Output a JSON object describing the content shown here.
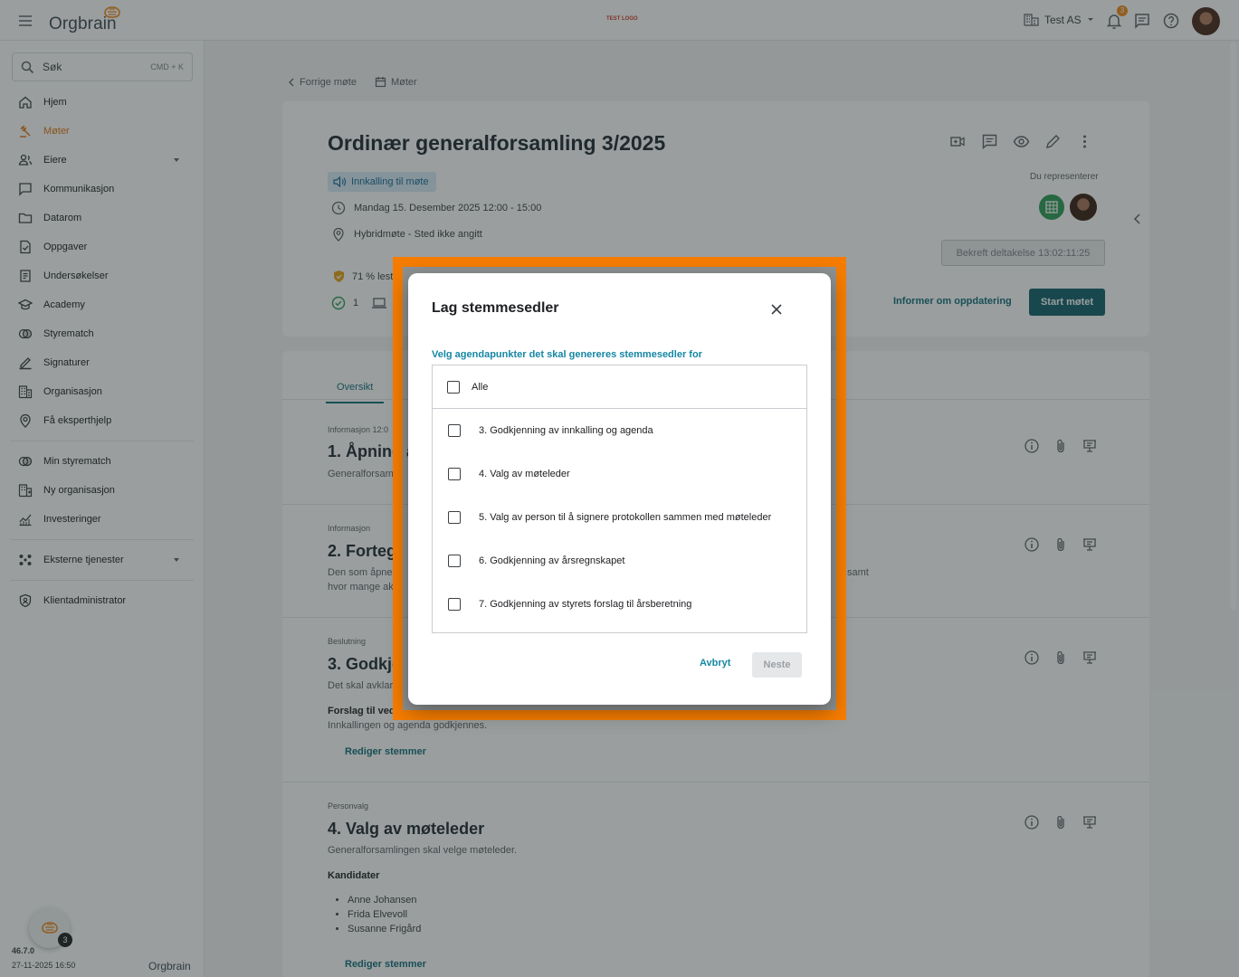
{
  "app": {
    "logo_text": "Orgbrain",
    "env_badge": "TEST LOGO",
    "org_name": "Test AS",
    "notification_count": "3"
  },
  "sidebar": {
    "search_label": "Søk",
    "search_shortcut": "CMD + K",
    "items": [
      {
        "label": "Hjem",
        "icon": "home-icon"
      },
      {
        "label": "Møter",
        "icon": "gavel-icon"
      },
      {
        "label": "Eiere",
        "icon": "owners-icon"
      },
      {
        "label": "Kommunikasjon",
        "icon": "chat-icon"
      },
      {
        "label": "Datarom",
        "icon": "folder-icon"
      },
      {
        "label": "Oppgaver",
        "icon": "task-icon"
      },
      {
        "label": "Undersøkelser",
        "icon": "survey-icon"
      },
      {
        "label": "Academy",
        "icon": "academy-icon"
      },
      {
        "label": "Styrematch",
        "icon": "match-icon"
      },
      {
        "label": "Signaturer",
        "icon": "signature-icon"
      },
      {
        "label": "Organisasjon",
        "icon": "organization-icon"
      },
      {
        "label": "Få eksperthjelp",
        "icon": "expert-icon"
      }
    ],
    "secondary_items": [
      {
        "label": "Min styrematch",
        "icon": "match-icon"
      },
      {
        "label": "Ny organisasjon",
        "icon": "new-organization-icon"
      },
      {
        "label": "Investeringer",
        "icon": "investments-icon"
      }
    ],
    "external_services": "Eksterne tjenester",
    "client_admin": "Klientadministrator",
    "version": "46.7.0",
    "build_date": "27-11-2025 16:50",
    "footer_logo": "Orgbrain",
    "fab_badge": "3"
  },
  "breadcrumb": {
    "previous": "Forrige møte",
    "meetings": "Møter"
  },
  "meeting": {
    "title": "Ordinær generalforsamling 3/2025",
    "status": "Innkalling til møte",
    "datetime": "Mandag 15. Desember 2025 12:00 - 15:00",
    "location": "Hybridmøte - Sted ikke angitt",
    "read_pct": "71 % lest",
    "check_count": "1",
    "represent_label": "Du representerer",
    "confirm_button": "Bekreft deltakelse 13:02:11:25",
    "inform_link": "Informer om oppdatering",
    "start_button": "Start møtet"
  },
  "tabs": {
    "overview": "Oversikt"
  },
  "agenda": [
    {
      "type": "Informasjon 12:0",
      "title": "1. Åpning a",
      "desc": "Generalforsam"
    },
    {
      "type": "Informasjon",
      "title": "2. Forteg",
      "desc1": "Den som åpne",
      "desc2": "hvor mange ak",
      "desc_tail": "samt"
    },
    {
      "type": "Beslutning",
      "title": "3. Godkje",
      "desc": "Det skal avklar",
      "sub": "Forslag til ved",
      "proposal": "Innkallingen og agenda godkjennes.",
      "link": "Rediger stemmer"
    },
    {
      "type": "Personvalg",
      "title": "4. Valg av møteleder",
      "desc": "Generalforsamlingen skal velge møteleder.",
      "sub": "Kandidater",
      "candidates": [
        "Anne Johansen",
        "Frida Elvevoll",
        "Susanne Frigård"
      ],
      "link": "Rediger stemmer"
    }
  ],
  "dialog": {
    "title": "Lag stemmesedler",
    "prompt": "Velg agendapunkter det skal genereres stemmesedler for",
    "all_label": "Alle",
    "options": [
      "3. Godkjenning av innkalling og agenda",
      "4. Valg av møteleder",
      "5. Valg av person til å signere protokollen sammen med møteleder",
      "6. Godkjenning av årsregnskapet",
      "7. Godkjenning av styrets forslag til årsberetning"
    ],
    "cancel": "Avbryt",
    "next": "Neste"
  },
  "colors": {
    "accent": "#15707e",
    "brand_orange": "#f08a1c",
    "highlight": "#f57c00",
    "dialog_link": "#1587a3"
  }
}
